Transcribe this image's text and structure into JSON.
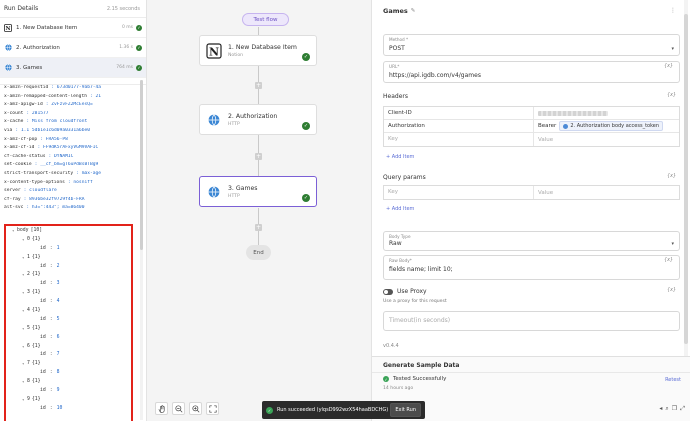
{
  "run_details": {
    "title": "Run Details",
    "duration": "2.15 seconds",
    "steps": [
      {
        "name": "1. New Database Item",
        "time": "0 ms",
        "icon": "notion-icon"
      },
      {
        "name": "2. Authorization",
        "time": "1.36 s",
        "icon": "globe-icon"
      },
      {
        "name": "3. Games",
        "time": "764 ms",
        "icon": "globe-icon"
      }
    ],
    "headers_output": [
      {
        "k": "x-amzn-requestid",
        "v": ": 673d0177-9ab7-4a"
      },
      {
        "k": "x-amzn-remapped-content-length",
        "v": ": 21"
      },
      {
        "k": "x-amz-apigw-id",
        "v": ": ZvFzvFZ2McEesQ="
      },
      {
        "k": "x-count",
        "v": ": 281577"
      },
      {
        "k": "x-cache",
        "v": ": Miss from cloudfront"
      },
      {
        "k": "via",
        "v": ": 1.1 5db1e1c6d09a0331a6be0"
      },
      {
        "k": "x-amz-cf-pop",
        "v": ": FRA56-P8"
      },
      {
        "k": "x-amz-cf-id",
        "v": ": FF9dK5rAFxyVGM9VAFIC"
      },
      {
        "k": "cf-cache-status",
        "v": ": DYNAMIC"
      },
      {
        "k": "set-cookie",
        "v": ": __cf_bm=gT6uPdBsBTBg9"
      },
      {
        "k": "strict-transport-security",
        "v": ": max-age"
      },
      {
        "k": "x-content-type-options",
        "v": ": nosniff"
      },
      {
        "k": "server",
        "v": ": cloudflare"
      },
      {
        "k": "cf-ray",
        "v": ": 8936be32f9729f4b-FRA"
      },
      {
        "k": "alt-svc",
        "v": ": h3=\":443\"; ma=86400"
      }
    ],
    "body_tree": {
      "root_key": "body",
      "root_count": "[10]",
      "items": [
        {
          "index": "0",
          "count": "{1}",
          "field": "id",
          "value": "1"
        },
        {
          "index": "1",
          "count": "{1}",
          "field": "id",
          "value": "2"
        },
        {
          "index": "2",
          "count": "{1}",
          "field": "id",
          "value": "3"
        },
        {
          "index": "3",
          "count": "{1}",
          "field": "id",
          "value": "4"
        },
        {
          "index": "4",
          "count": "{1}",
          "field": "id",
          "value": "5"
        },
        {
          "index": "5",
          "count": "{1}",
          "field": "id",
          "value": "6"
        },
        {
          "index": "6",
          "count": "{1}",
          "field": "id",
          "value": "7"
        },
        {
          "index": "7",
          "count": "{1}",
          "field": "id",
          "value": "8"
        },
        {
          "index": "8",
          "count": "{1}",
          "field": "id",
          "value": "9"
        },
        {
          "index": "9",
          "count": "{1}",
          "field": "id",
          "value": "10"
        }
      ]
    }
  },
  "canvas": {
    "test_flow_label": "Test flow",
    "nodes": [
      {
        "title": "1. New Database Item",
        "subtitle": "Notion"
      },
      {
        "title": "2. Authorization",
        "subtitle": "HTTP"
      },
      {
        "title": "3. Games",
        "subtitle": "HTTP"
      }
    ],
    "end_label": "End"
  },
  "toast": {
    "message": "Run succeeded (ylqsD992wzX54haaBDCHG)",
    "exit_label": "Exit Run"
  },
  "piece": {
    "title": "Games",
    "method": {
      "label": "Method *",
      "value": "POST"
    },
    "url": {
      "label": "URL*",
      "value": "https://api.igdb.com/v4/games"
    },
    "headers": {
      "title": "Headers",
      "rows": [
        {
          "key": "Client-ID",
          "value": ""
        },
        {
          "key": "Authorization",
          "value_prefix": "Bearer",
          "chip": "2. Authorization body access_token"
        }
      ],
      "key_placeholder": "Key",
      "value_placeholder": "Value",
      "add_label": "+ Add Item"
    },
    "query": {
      "title": "Query params",
      "key_placeholder": "Key",
      "value_placeholder": "Value",
      "add_label": "+ Add Item"
    },
    "body_type": {
      "label": "Body Type",
      "value": "Raw"
    },
    "raw_body": {
      "label": "Raw Body*",
      "value": "fields name; limit 10;"
    },
    "proxy": {
      "label": "Use Proxy",
      "description": "Use a proxy for this request"
    },
    "timeout_placeholder": "Timeout(in seconds)",
    "fx_label": "{x}",
    "version": "v0.4.4"
  },
  "sample": {
    "title": "Generate Sample Data",
    "status": "Tested Successfully",
    "ago": "14 hours ago",
    "retest_label": "Retest"
  }
}
